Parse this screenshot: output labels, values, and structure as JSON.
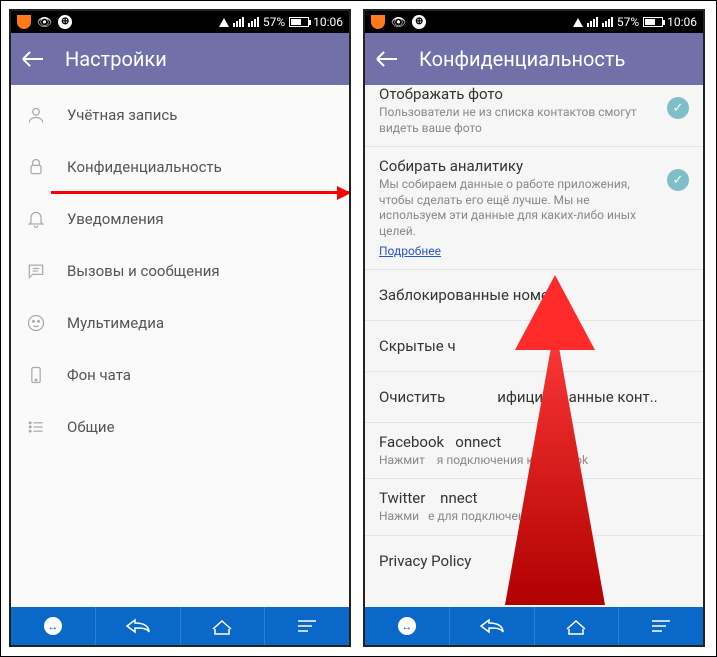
{
  "statusbar": {
    "time": "10:06",
    "battery_pct": "57%"
  },
  "phone1": {
    "header_title": "Настройки",
    "items": [
      {
        "label": "Учётная запись",
        "icon": "person"
      },
      {
        "label": "Конфиденциальность",
        "icon": "lock",
        "highlight": true
      },
      {
        "label": "Уведомления",
        "icon": "bell"
      },
      {
        "label": "Вызовы и сообщения",
        "icon": "chat"
      },
      {
        "label": "Мультимедиа",
        "icon": "face"
      },
      {
        "label": "Фон чата",
        "icon": "phone"
      },
      {
        "label": "Общие",
        "icon": "list"
      }
    ]
  },
  "phone2": {
    "header_title": "Конфиденциальность",
    "items": [
      {
        "title": "Отображать фото",
        "subtitle": "Пользователи не из списка контактов смогут видеть ваше фото",
        "toggle": true,
        "partial_top": true
      },
      {
        "title": "Собирать аналитику",
        "subtitle": "Мы собираем данные о работе приложения, чтобы сделать его ещё лучше. Мы не используем эти данные для каких-либо иных целей.",
        "link": "Подробнее",
        "toggle": true
      },
      {
        "title": "Заблокированные номера"
      },
      {
        "title": "Скрытые ч"
      },
      {
        "title": "Очистить              ифицированные конт.."
      },
      {
        "title": "Facebook   onnect",
        "subtitle": "Нажмит    я подключения к Facebook"
      },
      {
        "title": "Twitter    nnect",
        "subtitle": "Нажми   е для подключения к Twitter"
      },
      {
        "title": "Privacy Policy"
      }
    ]
  }
}
